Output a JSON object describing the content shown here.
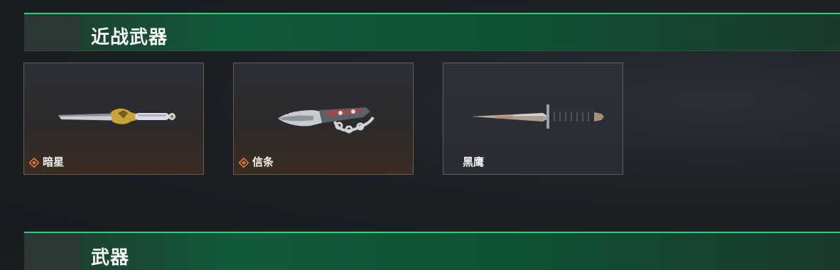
{
  "sections": [
    {
      "title": "近战武器"
    },
    {
      "title": "武器"
    }
  ],
  "melee_items": [
    {
      "name": "暗星",
      "icon": "knife-darkstar-icon",
      "rank_icon": "rank-diamond-icon"
    },
    {
      "name": "信条",
      "icon": "knife-creed-icon",
      "rank_icon": "rank-diamond-icon"
    },
    {
      "name": "黑鹰",
      "icon": "knife-blackhawk-icon"
    }
  ],
  "colors": {
    "accent": "#2dd07a",
    "header_green": "#12593a",
    "rank_orange": "#e0783a"
  }
}
